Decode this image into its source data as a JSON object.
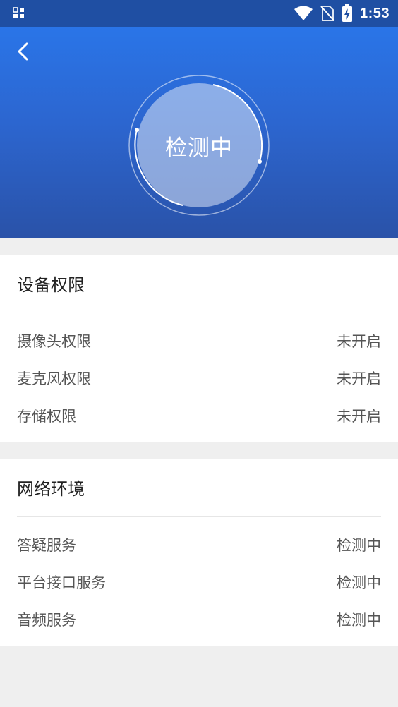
{
  "status_bar": {
    "time": "1:53",
    "icons": [
      "app-grid-icon",
      "wifi-icon",
      "no-sim-icon",
      "battery-charging-icon"
    ]
  },
  "header": {
    "back_icon": "chevron-left-icon",
    "status_label": "检测中",
    "background_color": "#2a66d6"
  },
  "device_permissions": {
    "title": "设备权限",
    "items": [
      {
        "label": "摄像头权限",
        "value": "未开启"
      },
      {
        "label": "麦克风权限",
        "value": "未开启"
      },
      {
        "label": "存储权限",
        "value": "未开启"
      }
    ]
  },
  "network": {
    "title": "网络环境",
    "items": [
      {
        "label": "答疑服务",
        "value": "检测中"
      },
      {
        "label": "平台接口服务",
        "value": "检测中"
      },
      {
        "label": "音频服务",
        "value": "检测中"
      }
    ]
  }
}
